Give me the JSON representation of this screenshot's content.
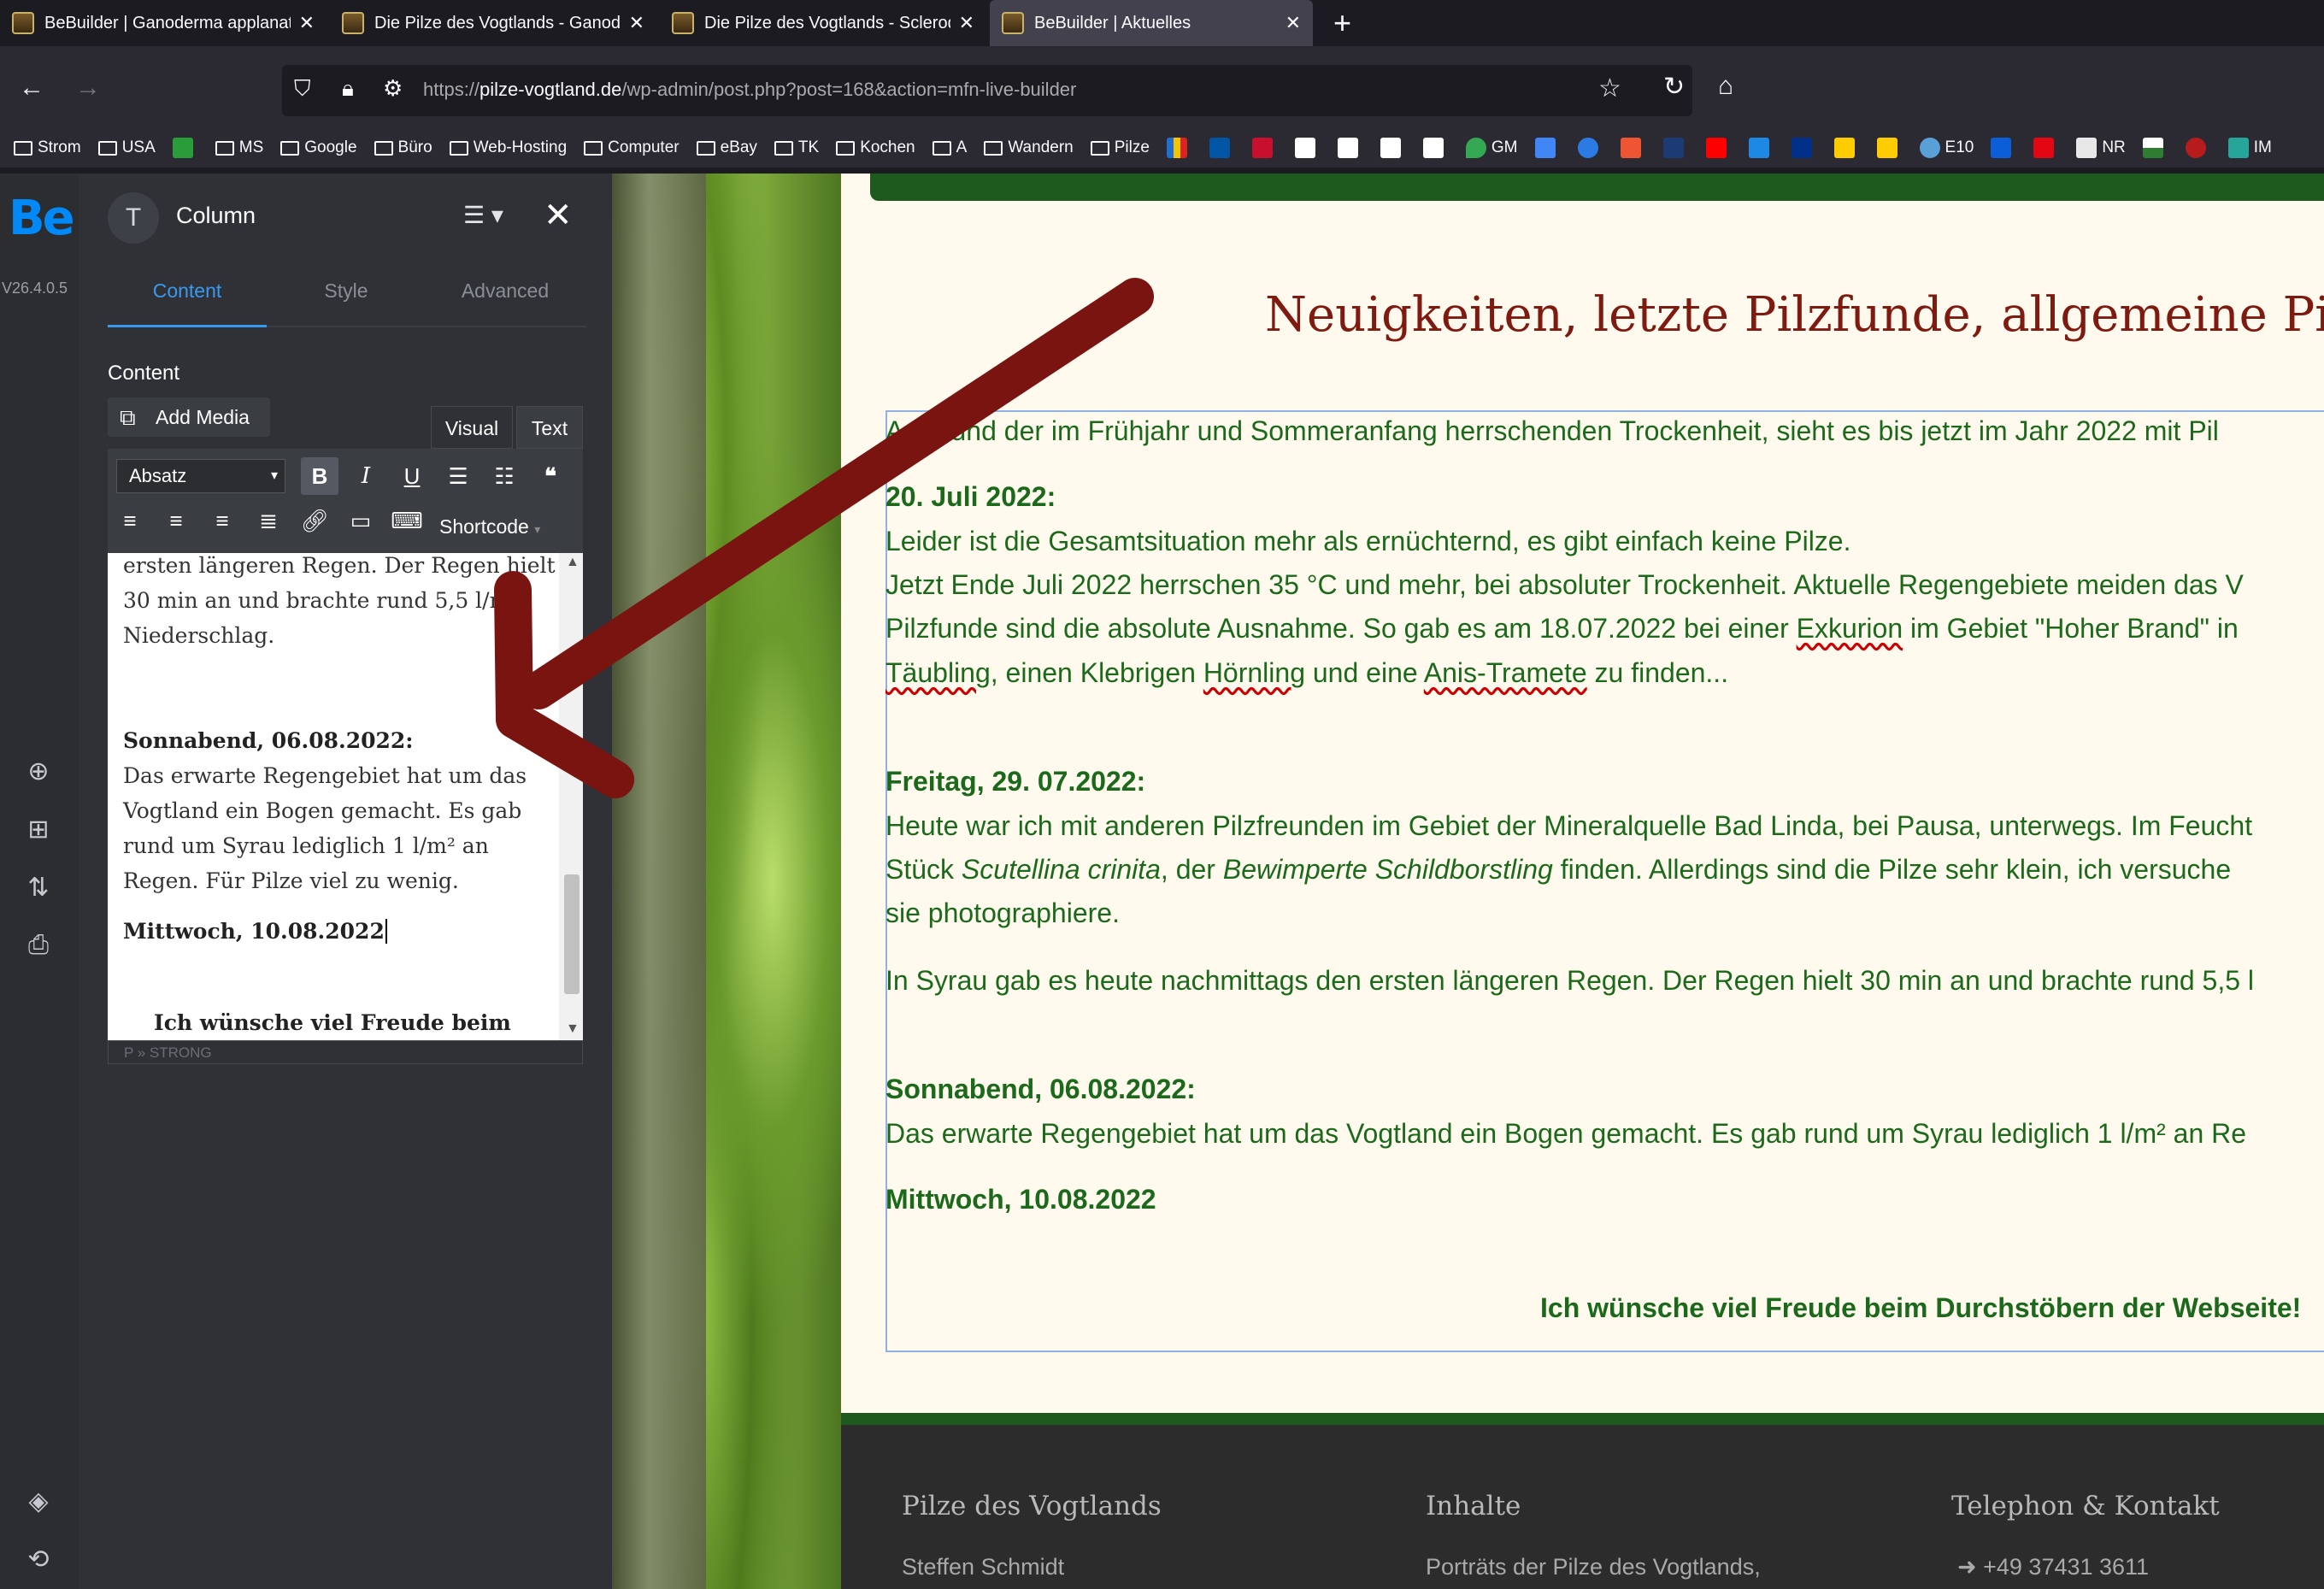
{
  "browser": {
    "tabs": [
      {
        "title": "BeBuilder | Ganoderma applanatum",
        "active": false
      },
      {
        "title": "Die Pilze des Vogtlands - Ganoderma",
        "active": false
      },
      {
        "title": "Die Pilze des Vogtlands - Scleroderma",
        "active": false
      },
      {
        "title": "BeBuilder | Aktuelles",
        "active": true
      }
    ],
    "url_prefix": "https://",
    "url_host": "pilze-vogtland.de",
    "url_path": "/wp-admin/post.php?post=168&action=mfn-live-builder",
    "bookmarks": [
      "Strom",
      "USA",
      "MS",
      "Google",
      "Büro",
      "Web-Hosting",
      "Computer",
      "eBay",
      "TK",
      "Kochen",
      "A",
      "Wandern",
      "Pilze",
      "GM",
      "E10",
      "NR",
      "IM"
    ]
  },
  "rail": {
    "logo": "Be",
    "version": "V26.4.0.5"
  },
  "panel": {
    "title": "Column",
    "tabs": [
      "Content",
      "Style",
      "Advanced"
    ],
    "content_label": "Content",
    "add_media": "Add Media",
    "visual": "Visual",
    "text": "Text",
    "format": "Absatz",
    "shortcode": "Shortcode",
    "path": "P » STRONG",
    "editor": {
      "p1": "ersten längeren Regen. Der Regen hielt 30 min an und brachte rund 5,5 l/m² Niederschlag.",
      "h2": "Sonnabend, 06.08.2022:",
      "p2": "Das erwarte Regengebiet hat um das Vogtland ein Bogen gemacht. Es gab rund um Syrau lediglich 1 l/m² an Regen. Für Pilze viel zu wenig.",
      "h3": "Mittwoch, 10.08.2022",
      "p3": "Ich wünsche viel Freude beim"
    }
  },
  "page": {
    "heading": "Neuigkeiten, letzte Pilzfunde, allgemeine Pil",
    "intro": "Aufgrund der im Frühjahr und Sommeranfang herrschenden Trockenheit, sieht es bis jetzt im Jahr 2022 mit Pil",
    "d1": "20. Juli 2022:",
    "l1": "Leider ist die Gesamtsituation mehr als ernüchternd, es gibt einfach keine Pilze.",
    "l2": "Jetzt Ende Juli 2022 herrschen 35 °C und mehr, bei absoluter Trockenheit. Aktuelle Regengebiete meiden das V",
    "l3a": "Pilzfunde sind die absolute Ausnahme. So gab es am 18.07.2022 bei einer ",
    "l3b": "Exkurion",
    "l3c": " im Gebiet \"Hoher Brand\" in",
    "l4a": "Täubling",
    "l4b": ", einen Klebrigen ",
    "l4c": "Hörnling",
    "l4d": " und eine ",
    "l4e": "Anis-Tramete",
    "l4f": " zu finden...",
    "d2": "Freitag, 29. 07.2022:",
    "l5": "Heute war ich mit anderen Pilzfreunden im Gebiet der Mineralquelle Bad Linda, bei Pausa, unterwegs. Im Feucht",
    "l6a": "Stück ",
    "l6b": "Scutellina crinita",
    "l6c": ", der ",
    "l6d": "Bewimperte Schildborstling",
    "l6e": " finden. Allerdings sind die Pilze sehr klein, ich versuche",
    "l7": "sie photographiere.",
    "l8": "In Syrau gab es heute nachmittags den ersten längeren Regen. Der Regen hielt 30 min an und brachte rund 5,5 l",
    "d3": "Sonnabend, 06.08.2022:",
    "l9": "Das erwarte Regengebiet hat um das Vogtland ein Bogen gemacht. Es gab rund um Syrau lediglich 1 l/m² an Re",
    "d4": "Mittwoch, 10.08.2022",
    "closing": "Ich wünsche viel Freude beim Durchstöbern der Webseite!"
  },
  "footer": {
    "col1_title": "Pilze des Vogtlands",
    "col1_text": "Steffen Schmidt",
    "col2_title": "Inhalte",
    "col2_text": "Porträts der Pilze des Vogtlands,",
    "col3_title": "Telephon & Kontakt",
    "col3_text": "➜ +49 37431 3611"
  },
  "colors": {
    "accent": "#0089f7",
    "heading": "#7f1a10",
    "text_green": "#1b6a1b",
    "arrow": "#7a1410"
  }
}
